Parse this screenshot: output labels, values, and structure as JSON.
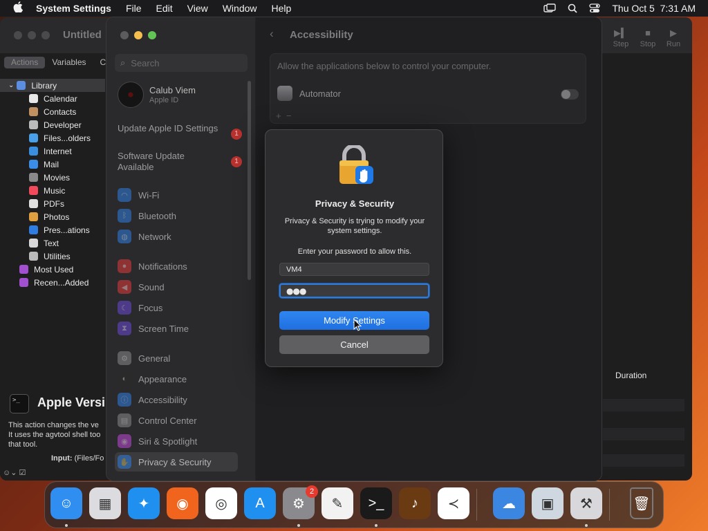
{
  "menubar": {
    "app_name": "System Settings",
    "menus": [
      "File",
      "Edit",
      "View",
      "Window",
      "Help"
    ],
    "datetime": "Thu Oct 5  7:31 AM"
  },
  "automator": {
    "title": "Untitled",
    "toolbar": {
      "step": "Step",
      "stop": "Stop",
      "run": "Run"
    },
    "segments": {
      "actions": "Actions",
      "variables": "Variables",
      "third": "C"
    },
    "library": [
      {
        "label": "Library",
        "color": "#5b8de0"
      },
      {
        "label": "Calendar",
        "color": "#e8e8e8"
      },
      {
        "label": "Contacts",
        "color": "#c09060"
      },
      {
        "label": "Developer",
        "color": "#bbbbbb"
      },
      {
        "label": "Files...olders",
        "color": "#4aa0e8"
      },
      {
        "label": "Internet",
        "color": "#3a8ee0"
      },
      {
        "label": "Mail",
        "color": "#3a8ee8"
      },
      {
        "label": "Movies",
        "color": "#8a8a8a"
      },
      {
        "label": "Music",
        "color": "#f24a5a"
      },
      {
        "label": "PDFs",
        "color": "#e0e0e0"
      },
      {
        "label": "Photos",
        "color": "#e0a040"
      },
      {
        "label": "Pres...ations",
        "color": "#2f7de0"
      },
      {
        "label": "Text",
        "color": "#d8d8d8"
      },
      {
        "label": "Utilities",
        "color": "#bbbbbb"
      },
      {
        "label": "Most Used",
        "color": "#a24fd0"
      },
      {
        "label": "Recen...Added",
        "color": "#a24fd0"
      }
    ],
    "action_title": "Apple Versi",
    "action_desc_1": "This action changes the ve",
    "action_desc_2": "It uses the agvtool shell too",
    "action_desc_3": "that tool.",
    "input_label": "Input:",
    "input_value": "(Files/Fo",
    "duration_header": "Duration"
  },
  "settings": {
    "search_placeholder": "Search",
    "user_name": "Calub Viem",
    "user_sub": "Apple ID",
    "notice1": "Update Apple ID Settings",
    "notice1_badge": "1",
    "notice2": "Software Update Available",
    "notice2_badge": "1",
    "items": [
      {
        "label": "Wi-Fi",
        "color": "#2f7de0",
        "glyph": "◠"
      },
      {
        "label": "Bluetooth",
        "color": "#2f7de0",
        "glyph": "ᛒ"
      },
      {
        "label": "Network",
        "color": "#2f7de0",
        "glyph": "◍"
      },
      {
        "label": "Notifications",
        "color": "#e03a3a",
        "glyph": "●"
      },
      {
        "label": "Sound",
        "color": "#e03a3a",
        "glyph": "◀"
      },
      {
        "label": "Focus",
        "color": "#6a4ad8",
        "glyph": "☾"
      },
      {
        "label": "Screen Time",
        "color": "#6a4ad8",
        "glyph": "⧗"
      },
      {
        "label": "General",
        "color": "#8a8a8c",
        "glyph": "⚙"
      },
      {
        "label": "Appearance",
        "color": "#2b2b2b",
        "glyph": "◐"
      },
      {
        "label": "Accessibility",
        "color": "#2f7de0",
        "glyph": "ⓘ"
      },
      {
        "label": "Control Center",
        "color": "#8a8a8c",
        "glyph": "▤"
      },
      {
        "label": "Siri & Spotlight",
        "color": "#c04ad8",
        "glyph": "◉"
      },
      {
        "label": "Privacy & Security",
        "color": "#2f7de0",
        "glyph": "✋"
      }
    ],
    "page_title": "Accessibility",
    "box_desc": "Allow the applications below to control your computer.",
    "app_name": "Automator",
    "plus_minus": "+  −"
  },
  "dialog": {
    "title": "Privacy & Security",
    "message": "Privacy & Security is trying to modify your system settings.",
    "prompt": "Enter your password to allow this.",
    "username": "VM4",
    "password": "●●●",
    "modify_label": "Modify Settings",
    "cancel_label": "Cancel"
  },
  "dock": {
    "badge": "2",
    "apps": [
      {
        "name": "finder-icon",
        "color": "#2f8ef0"
      },
      {
        "name": "launchpad-icon",
        "color": "#dcdce0"
      },
      {
        "name": "safari-icon",
        "color": "#1f8ff0"
      },
      {
        "name": "firefox-icon",
        "color": "#f0641e"
      },
      {
        "name": "chrome-icon",
        "color": "#ffffff"
      },
      {
        "name": "app-store-icon",
        "color": "#1f8ff0"
      },
      {
        "name": "system-settings-icon",
        "color": "#8a8a8e"
      },
      {
        "name": "textedit-icon",
        "color": "#f2f2f2"
      },
      {
        "name": "terminal-icon",
        "color": "#1a1a1a"
      },
      {
        "name": "garageband-icon",
        "color": "#6a3a12"
      },
      {
        "name": "vscode-icon",
        "color": "#ffffff"
      },
      {
        "name": "weather-icon",
        "color": "#3a86e0"
      },
      {
        "name": "preview-icon",
        "color": "#cfd8e0"
      },
      {
        "name": "automator-icon",
        "color": "#d8d8dc"
      },
      {
        "name": "trash-icon",
        "color": "#7a7a7c"
      }
    ]
  }
}
